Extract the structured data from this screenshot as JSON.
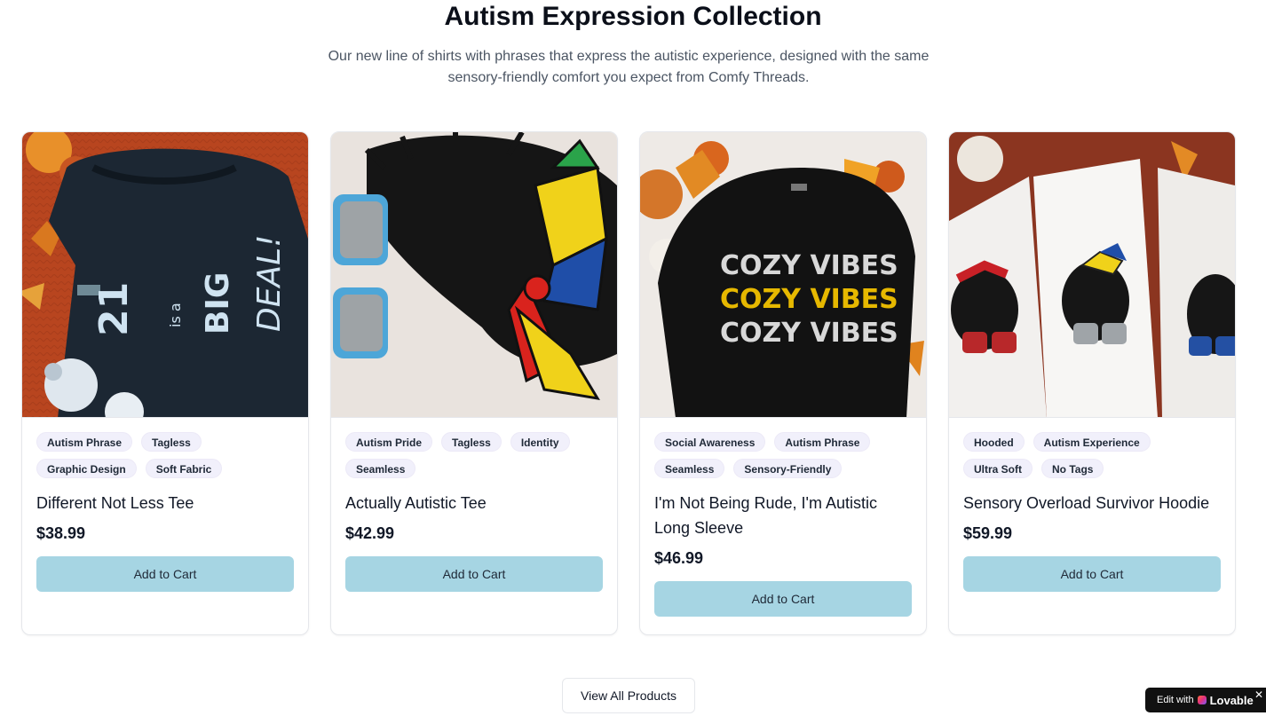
{
  "header": {
    "title": "Autism Expression Collection",
    "subtitle": "Our new line of shirts with phrases that express the autistic experience, designed with the same sensory-friendly comfort you expect from Comfy Threads."
  },
  "products": [
    {
      "name": "Different Not Less Tee",
      "price": "$38.99",
      "tags": [
        "Autism Phrase",
        "Tagless",
        "Graphic Design",
        "Soft Fabric"
      ],
      "button": "Add to Cart",
      "image_text": [
        "21",
        "is a",
        "BIG",
        "DEAL!"
      ]
    },
    {
      "name": "Actually Autistic Tee",
      "price": "$42.99",
      "tags": [
        "Autism Pride",
        "Tagless",
        "Identity",
        "Seamless"
      ],
      "button": "Add to Cart"
    },
    {
      "name": "I'm Not Being Rude, I'm Autistic Long Sleeve",
      "price": "$46.99",
      "tags": [
        "Social Awareness",
        "Autism Phrase",
        "Seamless",
        "Sensory-Friendly"
      ],
      "button": "Add to Cart",
      "image_text": [
        "COZY VIBES",
        "COZY VIBES",
        "COZY VIBES"
      ]
    },
    {
      "name": "Sensory Overload Survivor Hoodie",
      "price": "$59.99",
      "tags": [
        "Hooded",
        "Autism Experience",
        "Ultra Soft",
        "No Tags"
      ],
      "button": "Add to Cart"
    }
  ],
  "footer": {
    "view_all": "View All Products"
  },
  "badge": {
    "prefix": "Edit with",
    "brand": "Lovable",
    "close": "✕"
  },
  "colors": {
    "button_bg": "#a6d5e3",
    "tag_bg": "#f1f0fb"
  }
}
